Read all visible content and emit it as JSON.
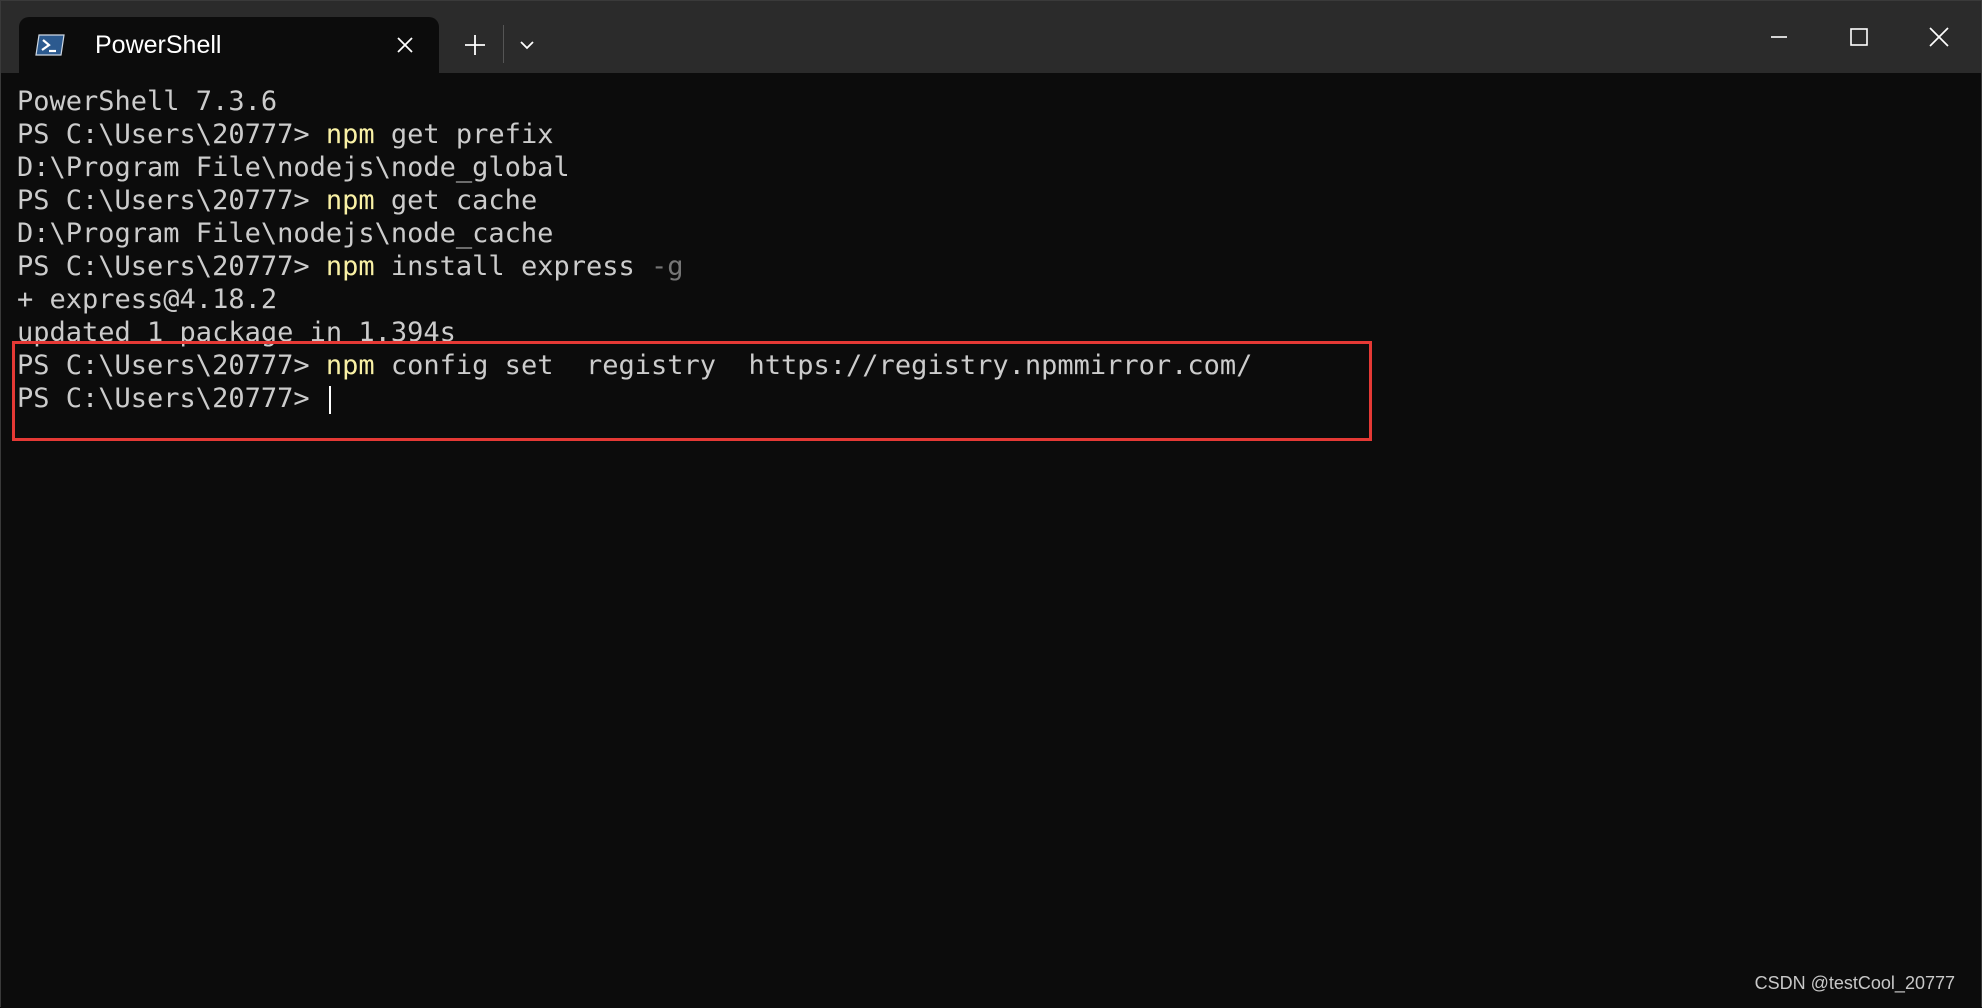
{
  "tab": {
    "title": "PowerShell"
  },
  "icons": {
    "tab_icon": "powershell-icon",
    "tab_close": "close-icon",
    "new_tab": "plus-icon",
    "dropdown": "chevron-down-icon",
    "minimize": "minimize-icon",
    "maximize": "maximize-icon",
    "close": "close-icon"
  },
  "colors": {
    "background": "#0c0c0c",
    "titlebar": "#2b2b2b",
    "text": "#cccccc",
    "command": "#f9f1a5",
    "flag": "#767676",
    "highlight": "#e53935"
  },
  "terminal": {
    "header": "PowerShell 7.3.6",
    "prompt": "PS C:\\Users\\20777> ",
    "lines": [
      {
        "cmd": "npm",
        "args": " get prefix"
      },
      {
        "output": "D:\\Program File\\nodejs\\node_global"
      },
      {
        "cmd": "npm",
        "args": " get cache"
      },
      {
        "output": "D:\\Program File\\nodejs\\node_cache"
      },
      {
        "cmd": "npm",
        "args": " install express ",
        "flag": "-g"
      },
      {
        "output": "+ express@4.18.2"
      },
      {
        "output": "updated 1 package in 1.394s"
      },
      {
        "cmd": "npm",
        "args": " config set  registry  https://registry.npmmirror.com/"
      }
    ]
  },
  "watermark": "CSDN @testCool_20777"
}
